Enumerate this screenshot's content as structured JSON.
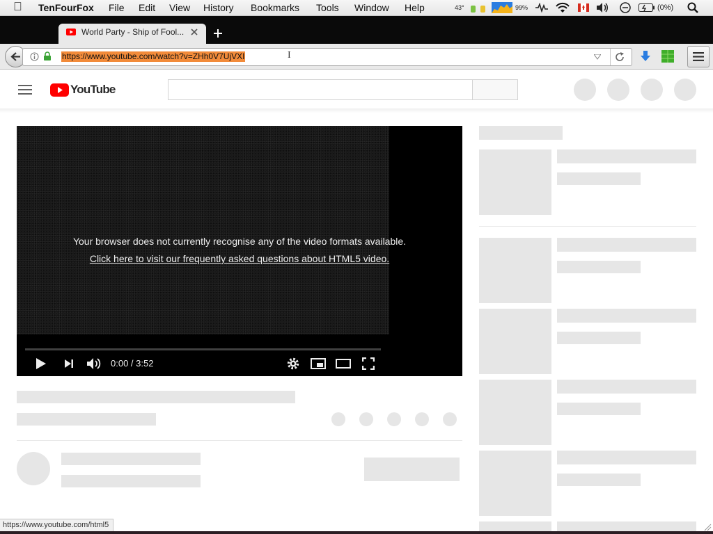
{
  "menubar": {
    "app": "TenFourFox",
    "items": [
      "File",
      "Edit",
      "View",
      "History",
      "Bookmarks",
      "Tools",
      "Window",
      "Help"
    ],
    "temperature": "43°",
    "percent_a": "99%",
    "battery": "(0%)"
  },
  "tab": {
    "title": "World Party - Ship of Fool..."
  },
  "urlbar": {
    "url": "https://www.youtube.com/watch?v=ZHh0V7UjVXI"
  },
  "youtube": {
    "logo": "YouTube"
  },
  "player": {
    "error_message": "Your browser does not currently recognise any of the video formats available.",
    "faq_link": "Click here to visit our frequently asked questions about HTML5 video.",
    "time": "0:00 / 3:52"
  },
  "statusbar": {
    "url": "https://www.youtube.com/html5"
  },
  "colors": {
    "youtube_red": "#ff0000",
    "accent_blue": "#2a7de1",
    "url_highlight": "#f28b3a"
  }
}
